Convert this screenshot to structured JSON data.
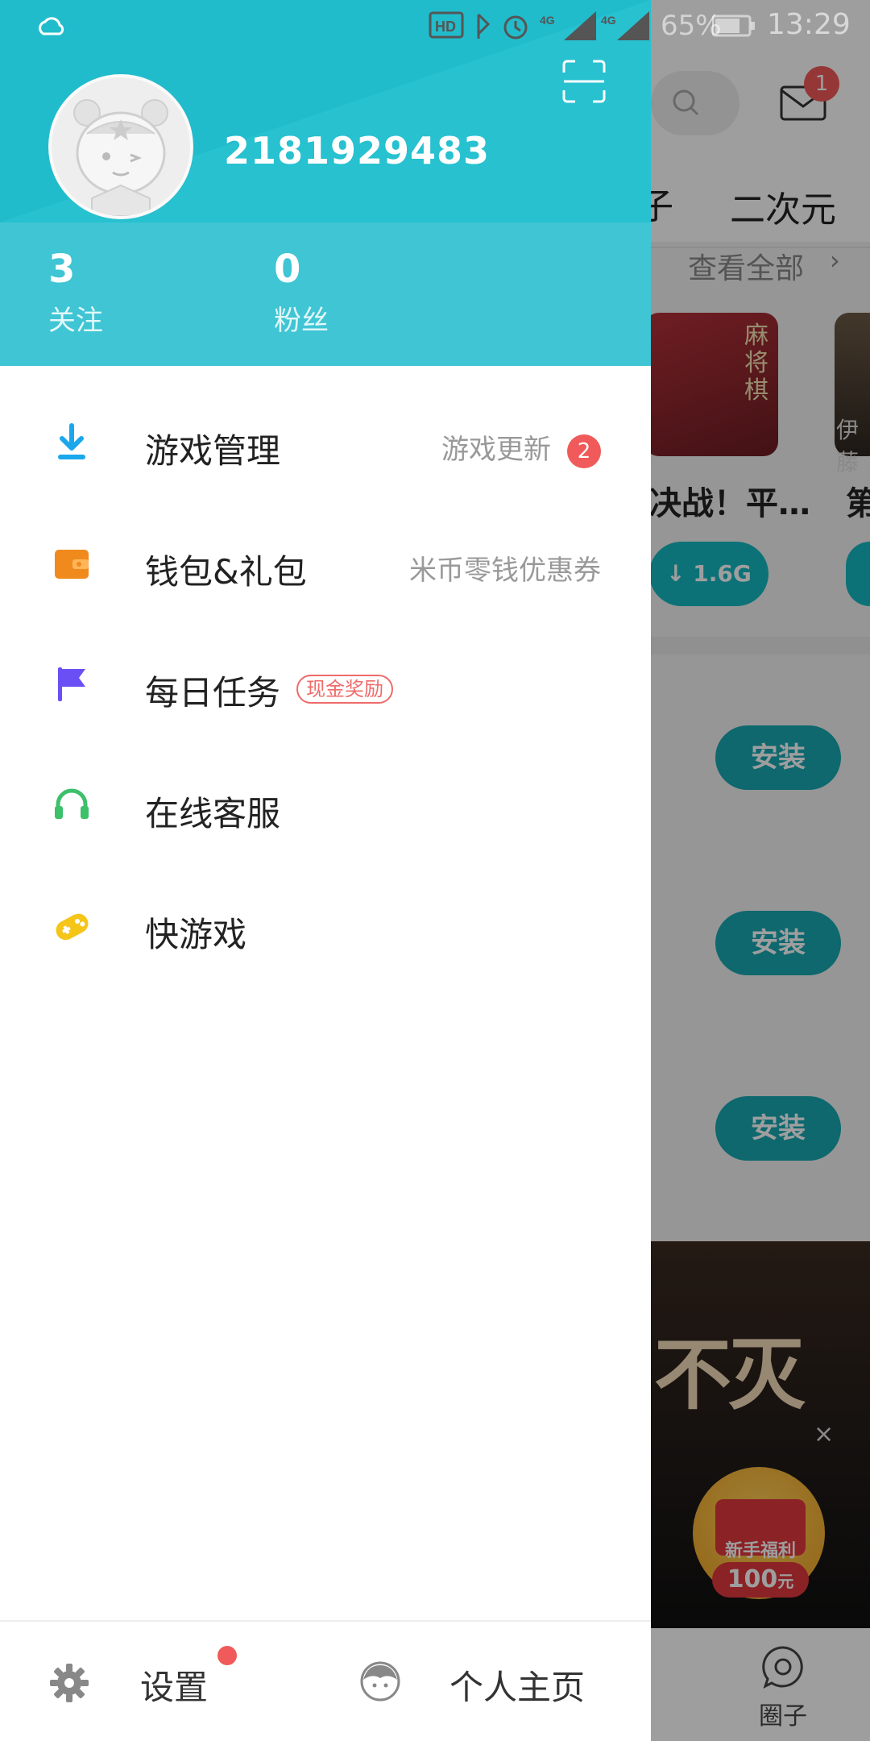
{
  "status_bar": {
    "battery": "65%",
    "time": "13:29"
  },
  "background_app": {
    "mail_badge": "1",
    "tab_partial": "子",
    "tab_label": "二次元",
    "view_all": "查看全部",
    "game_card_text": "麻将棋",
    "game_card2_text": "伊藤",
    "game_name_1": "决战！平…",
    "game_name_2": "第",
    "download_size": "↓ 1.6G",
    "install_label": "安装",
    "banner_text": "不灭",
    "gift_label": "新手福利",
    "gift_amount": "100",
    "gift_unit": "元",
    "nav_circle_label": "圈子"
  },
  "drawer": {
    "username": "2181929483",
    "stats": [
      {
        "value": "3",
        "label": "关注"
      },
      {
        "value": "0",
        "label": "粉丝"
      }
    ],
    "menu": [
      {
        "label": "游戏管理",
        "right_text": "游戏更新",
        "badge": "2",
        "icon": "download-icon",
        "color": "#1aa7ec"
      },
      {
        "label": "钱包&礼包",
        "right_text": "米币零钱优惠券",
        "icon": "wallet-icon",
        "color": "#f08a1c"
      },
      {
        "label": "每日任务",
        "tag": "现金奖励",
        "icon": "flag-icon",
        "color": "#6a4ff5"
      },
      {
        "label": "在线客服",
        "icon": "headset-icon",
        "color": "#3cc06a"
      },
      {
        "label": "快游戏",
        "icon": "gamepad-icon",
        "color": "#f5c518"
      }
    ],
    "footer": {
      "settings_label": "设置",
      "profile_label": "个人主页"
    }
  }
}
